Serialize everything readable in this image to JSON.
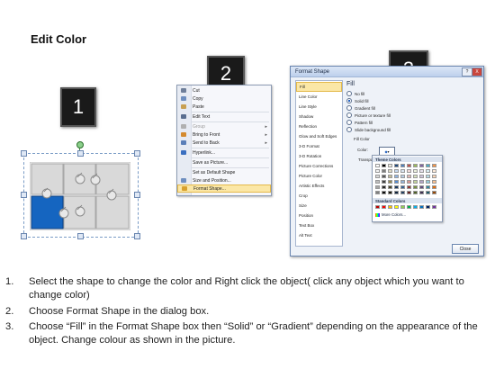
{
  "title": "Edit Color",
  "badges": {
    "one": "1",
    "two": "2",
    "three": "3"
  },
  "context_menu": {
    "items": [
      {
        "label": "Cut",
        "icon": "scissors-icon",
        "color": "#6f7f9a"
      },
      {
        "label": "Copy",
        "icon": "copy-icon",
        "color": "#6f8fc0"
      },
      {
        "label": "Paste",
        "icon": "paste-icon",
        "color": "#c8a052"
      },
      {
        "label": "Edit Text",
        "icon": "edit-text-icon",
        "color": "#5a6e8f"
      },
      {
        "label": "Group",
        "icon": "group-icon",
        "color": "#b0b0b0",
        "disabled": true,
        "submenu": true
      },
      {
        "label": "Bring to Front",
        "icon": "bring-front-icon",
        "color": "#d48a2e",
        "submenu": true
      },
      {
        "label": "Send to Back",
        "icon": "send-back-icon",
        "color": "#5b7fb8",
        "submenu": true
      },
      {
        "label": "Hyperlink...",
        "icon": "hyperlink-icon",
        "color": "#3a6fc0"
      },
      {
        "label": "Save as Picture...",
        "icon": "",
        "color": ""
      },
      {
        "label": "Set as Default Shape",
        "icon": "",
        "color": ""
      },
      {
        "label": "Size and Position...",
        "icon": "size-position-icon",
        "color": "#6f8fc0"
      },
      {
        "label": "Format Shape...",
        "icon": "format-shape-icon",
        "color": "#d8a12e",
        "highlighted": true
      }
    ]
  },
  "dialog": {
    "title": "Format Shape",
    "help": "?",
    "close_x": "X",
    "categories": [
      "Fill",
      "Line Color",
      "Line Style",
      "Shadow",
      "Reflection",
      "Glow and Soft Edges",
      "3-D Format",
      "3-D Rotation",
      "Picture Corrections",
      "Picture Color",
      "Artistic Effects",
      "Crop",
      "Size",
      "Position",
      "Text Box",
      "Alt Text"
    ],
    "selected_category": "Fill",
    "fill_heading": "Fill",
    "fill_options": [
      {
        "label": "No fill",
        "checked": false
      },
      {
        "label": "Solid fill",
        "checked": true
      },
      {
        "label": "Gradient fill",
        "checked": false
      },
      {
        "label": "Picture or texture fill",
        "checked": false
      },
      {
        "label": "Pattern fill",
        "checked": false
      },
      {
        "label": "Slide background fill",
        "checked": false
      }
    ],
    "fill_color_label": "Fill Color",
    "color_label": "Color:",
    "transparency_label": "Transpa",
    "close_button": "Close"
  },
  "palette": {
    "theme_label": "Theme Colors",
    "standard_label": "Standard Colors",
    "more_label": "More Colors...",
    "theme_top": [
      "#ffffff",
      "#000000",
      "#eeece1",
      "#1f497d",
      "#4f81bd",
      "#c0504d",
      "#9bbb59",
      "#8064a2",
      "#4bacc6",
      "#f79646"
    ],
    "theme_shades": [
      [
        "#f2f2f2",
        "#7f7f7f",
        "#ddd9c3",
        "#c6d9f0",
        "#dbe5f1",
        "#f2dcdb",
        "#ebf1dd",
        "#e5e0ec",
        "#dbeef3",
        "#fdeada"
      ],
      [
        "#d8d8d8",
        "#595959",
        "#c4bd97",
        "#8db3e2",
        "#b8cce4",
        "#e5b9b7",
        "#d7e3bc",
        "#ccc1d9",
        "#b7dde8",
        "#fbd5b5"
      ],
      [
        "#bfbfbf",
        "#3f3f3f",
        "#938953",
        "#548dd4",
        "#95b3d7",
        "#d99694",
        "#c3d69b",
        "#b2a2c7",
        "#92cddc",
        "#fac08f"
      ],
      [
        "#a5a5a5",
        "#262626",
        "#494429",
        "#17365d",
        "#366092",
        "#953734",
        "#76923c",
        "#5f497a",
        "#31859b",
        "#e36c09"
      ],
      [
        "#7f7f7f",
        "#0c0c0c",
        "#1d1b10",
        "#0f243e",
        "#244061",
        "#632423",
        "#4f6128",
        "#3f3151",
        "#205867",
        "#974806"
      ]
    ],
    "standard": [
      "#c00000",
      "#ff0000",
      "#ffc000",
      "#ffff00",
      "#92d050",
      "#00b050",
      "#00b0f0",
      "#0070c0",
      "#002060",
      "#7030a0"
    ]
  },
  "puzzle": {
    "selected_color": "#1565c0",
    "piece_color": "#d9d9d9"
  },
  "steps": [
    {
      "num": "1.",
      "text": "Select the shape to change the color and Right click the object( click any object which you want to change color)"
    },
    {
      "num": "2.",
      "text": "Choose Format Shape in the dialog box."
    },
    {
      "num": "3.",
      "text": "Choose “Fill” in the Format Shape box then “Solid” or “Gradient” depending on the appearance of the object. Change colour as shown in the picture."
    }
  ]
}
